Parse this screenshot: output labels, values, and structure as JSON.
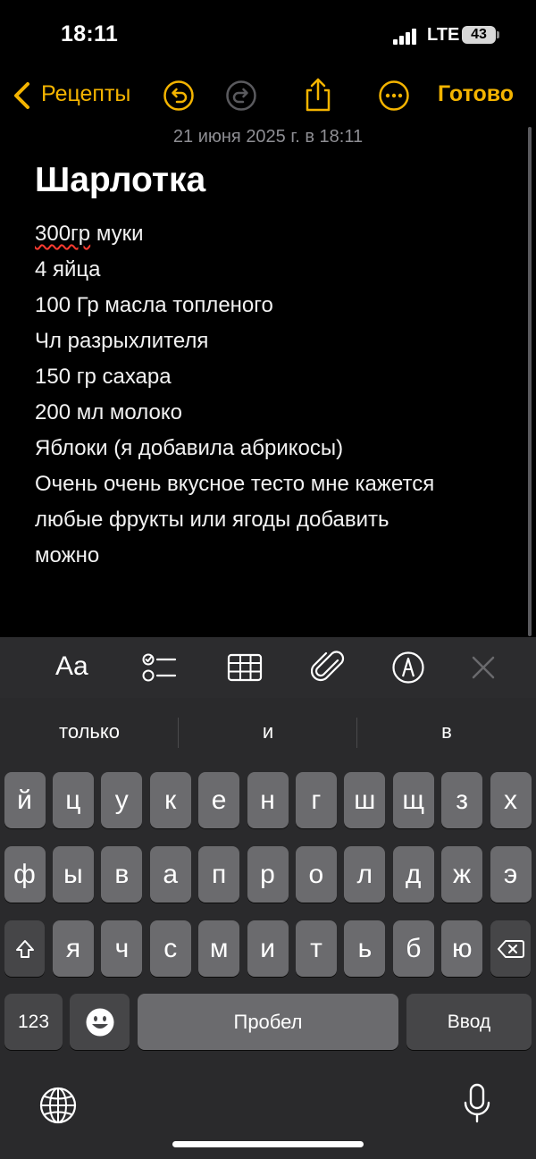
{
  "status": {
    "time": "18:11",
    "network": "LTE",
    "battery": "43"
  },
  "nav": {
    "back_label": "Рецепты",
    "done_label": "Готово",
    "accent_color": "#f4b400",
    "icons": [
      "undo-icon",
      "redo-icon",
      "share-icon",
      "more-icon"
    ]
  },
  "note": {
    "date": "21 июня 2025 г. в 18:11",
    "title": "Шарлотка",
    "first_line_misspelled": "300гр",
    "first_line_rest": " муки",
    "lines": [
      "4 яйца",
      "100 Гр масла топленого",
      "Чл разрыхлителя",
      "150 гр сахара",
      "200 мл молоко",
      "Яблоки (я добавила абрикосы)",
      "Очень очень вкусное тесто мне кажется",
      "любые фрукты или ягоды добавить",
      "можно"
    ]
  },
  "format_toolbar": {
    "aa_label": "Aa",
    "icons": [
      "checklist-icon",
      "table-icon",
      "attachment-icon",
      "markup-icon",
      "close-icon"
    ]
  },
  "keyboard": {
    "suggestions": [
      "только",
      "и",
      "в"
    ],
    "row1": [
      "й",
      "ц",
      "у",
      "к",
      "е",
      "н",
      "г",
      "ш",
      "щ",
      "з",
      "х"
    ],
    "row2": [
      "ф",
      "ы",
      "в",
      "а",
      "п",
      "р",
      "о",
      "л",
      "д",
      "ж",
      "э"
    ],
    "row3": [
      "я",
      "ч",
      "с",
      "м",
      "и",
      "т",
      "ь",
      "б",
      "ю"
    ],
    "numbers_label": "123",
    "space_label": "Пробел",
    "return_label": "Ввод"
  }
}
